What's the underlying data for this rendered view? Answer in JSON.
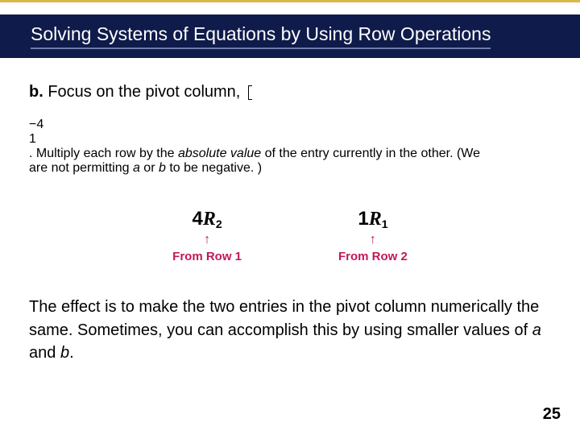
{
  "title": "Solving Systems of Equations by Using Row Operations",
  "step_label": "b.",
  "para1_before": " Focus on the pivot column, ",
  "matrix": {
    "r1": "−4",
    "r2": "1"
  },
  "para1_after": "  Multiply each row by",
  "para1_line2_a": "the ",
  "para1_line2_ital": "absolute value",
  "para1_line2_b": " of the entry currently in the other. (We",
  "para1_line3_a": "are not permitting ",
  "para1_line3_var_a": "a",
  "para1_line3_b": " or ",
  "para1_line3_var_b": "b",
  "para1_line3_c": " to be negative. )",
  "left": {
    "coef": "4",
    "var": "R",
    "sub": "2",
    "from": "From Row 1"
  },
  "right": {
    "coef": "1",
    "var": "R",
    "sub": "1",
    "from": "From Row 2"
  },
  "arrow": "↑",
  "para2_a": "The effect is to make the two entries in the pivot column numerically the same. Sometimes, you can accomplish this by using smaller values of ",
  "para2_var_a": "a",
  "para2_b": " and ",
  "para2_var_b": "b",
  "para2_c": ".",
  "pagenum": "25"
}
